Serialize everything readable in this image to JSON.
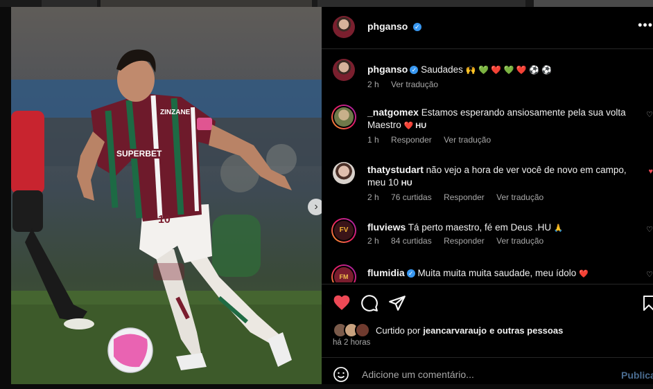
{
  "post": {
    "author": "phganso",
    "caption": {
      "text": "Saudades",
      "emojis": "🙌 💚 ❤️ 💚 ❤️ ⚽ ⚽",
      "time": "2 h",
      "translate": "Ver tradução"
    },
    "slides": {
      "count": 2,
      "active": 1
    }
  },
  "comments": [
    {
      "user": "_natgomex",
      "verified": false,
      "text": "Estamos esperando ansiosamente pela sua volta Maestro",
      "suffix": "❤️ HU",
      "time": "1 h",
      "likes": "",
      "reply": "Responder",
      "translate": "Ver tradução"
    },
    {
      "user": "thatystudart",
      "verified": false,
      "text": "não vejo a hora de ver você de novo em campo, meu 10",
      "suffix": "HU",
      "time": "2 h",
      "likes": "76 curtidas",
      "reply": "Responder",
      "translate": "Ver tradução"
    },
    {
      "user": "fluviews",
      "verified": false,
      "text": "Tá perto maestro, fé em Deus .HU",
      "suffix": "🙏",
      "time": "2 h",
      "likes": "84 curtidas",
      "reply": "Responder",
      "translate": "Ver tradução"
    },
    {
      "user": "flumidia",
      "verified": true,
      "text": "Muita muita muita saudade, meu ídolo",
      "suffix": "❤️",
      "time": "",
      "likes": "",
      "reply": "",
      "translate": ""
    }
  ],
  "footer": {
    "liked_prefix": "Curtido por",
    "liked_user": "jeancarvaraujo",
    "liked_suffix": "e outras pessoas",
    "time": "há 2 horas",
    "add_comment_placeholder": "Adicione um comentário...",
    "publish_label": "Publicar"
  },
  "icons": {
    "like": "heart-filled-icon",
    "comment": "comment-icon",
    "share": "send-icon",
    "save": "bookmark-icon",
    "more": "more-horizontal-icon",
    "emoji": "emoji-icon",
    "next": "chevron-right-icon"
  },
  "colors": {
    "like_red": "#ed4956",
    "verified_blue": "#3897f0",
    "publish_disabled": "#4a6c90"
  }
}
